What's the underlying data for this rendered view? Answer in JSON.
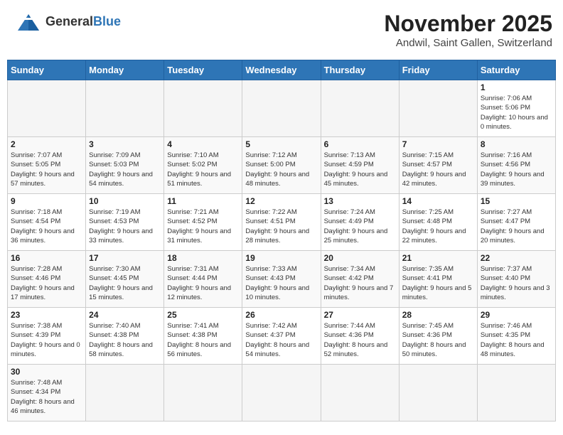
{
  "header": {
    "logo_general": "General",
    "logo_blue": "Blue",
    "month": "November 2025",
    "location": "Andwil, Saint Gallen, Switzerland"
  },
  "days_of_week": [
    "Sunday",
    "Monday",
    "Tuesday",
    "Wednesday",
    "Thursday",
    "Friday",
    "Saturday"
  ],
  "weeks": [
    [
      {
        "day": "",
        "info": ""
      },
      {
        "day": "",
        "info": ""
      },
      {
        "day": "",
        "info": ""
      },
      {
        "day": "",
        "info": ""
      },
      {
        "day": "",
        "info": ""
      },
      {
        "day": "",
        "info": ""
      },
      {
        "day": "1",
        "info": "Sunrise: 7:06 AM\nSunset: 5:06 PM\nDaylight: 10 hours and 0 minutes."
      }
    ],
    [
      {
        "day": "2",
        "info": "Sunrise: 7:07 AM\nSunset: 5:05 PM\nDaylight: 9 hours and 57 minutes."
      },
      {
        "day": "3",
        "info": "Sunrise: 7:09 AM\nSunset: 5:03 PM\nDaylight: 9 hours and 54 minutes."
      },
      {
        "day": "4",
        "info": "Sunrise: 7:10 AM\nSunset: 5:02 PM\nDaylight: 9 hours and 51 minutes."
      },
      {
        "day": "5",
        "info": "Sunrise: 7:12 AM\nSunset: 5:00 PM\nDaylight: 9 hours and 48 minutes."
      },
      {
        "day": "6",
        "info": "Sunrise: 7:13 AM\nSunset: 4:59 PM\nDaylight: 9 hours and 45 minutes."
      },
      {
        "day": "7",
        "info": "Sunrise: 7:15 AM\nSunset: 4:57 PM\nDaylight: 9 hours and 42 minutes."
      },
      {
        "day": "8",
        "info": "Sunrise: 7:16 AM\nSunset: 4:56 PM\nDaylight: 9 hours and 39 minutes."
      }
    ],
    [
      {
        "day": "9",
        "info": "Sunrise: 7:18 AM\nSunset: 4:54 PM\nDaylight: 9 hours and 36 minutes."
      },
      {
        "day": "10",
        "info": "Sunrise: 7:19 AM\nSunset: 4:53 PM\nDaylight: 9 hours and 33 minutes."
      },
      {
        "day": "11",
        "info": "Sunrise: 7:21 AM\nSunset: 4:52 PM\nDaylight: 9 hours and 31 minutes."
      },
      {
        "day": "12",
        "info": "Sunrise: 7:22 AM\nSunset: 4:51 PM\nDaylight: 9 hours and 28 minutes."
      },
      {
        "day": "13",
        "info": "Sunrise: 7:24 AM\nSunset: 4:49 PM\nDaylight: 9 hours and 25 minutes."
      },
      {
        "day": "14",
        "info": "Sunrise: 7:25 AM\nSunset: 4:48 PM\nDaylight: 9 hours and 22 minutes."
      },
      {
        "day": "15",
        "info": "Sunrise: 7:27 AM\nSunset: 4:47 PM\nDaylight: 9 hours and 20 minutes."
      }
    ],
    [
      {
        "day": "16",
        "info": "Sunrise: 7:28 AM\nSunset: 4:46 PM\nDaylight: 9 hours and 17 minutes."
      },
      {
        "day": "17",
        "info": "Sunrise: 7:30 AM\nSunset: 4:45 PM\nDaylight: 9 hours and 15 minutes."
      },
      {
        "day": "18",
        "info": "Sunrise: 7:31 AM\nSunset: 4:44 PM\nDaylight: 9 hours and 12 minutes."
      },
      {
        "day": "19",
        "info": "Sunrise: 7:33 AM\nSunset: 4:43 PM\nDaylight: 9 hours and 10 minutes."
      },
      {
        "day": "20",
        "info": "Sunrise: 7:34 AM\nSunset: 4:42 PM\nDaylight: 9 hours and 7 minutes."
      },
      {
        "day": "21",
        "info": "Sunrise: 7:35 AM\nSunset: 4:41 PM\nDaylight: 9 hours and 5 minutes."
      },
      {
        "day": "22",
        "info": "Sunrise: 7:37 AM\nSunset: 4:40 PM\nDaylight: 9 hours and 3 minutes."
      }
    ],
    [
      {
        "day": "23",
        "info": "Sunrise: 7:38 AM\nSunset: 4:39 PM\nDaylight: 9 hours and 0 minutes."
      },
      {
        "day": "24",
        "info": "Sunrise: 7:40 AM\nSunset: 4:38 PM\nDaylight: 8 hours and 58 minutes."
      },
      {
        "day": "25",
        "info": "Sunrise: 7:41 AM\nSunset: 4:38 PM\nDaylight: 8 hours and 56 minutes."
      },
      {
        "day": "26",
        "info": "Sunrise: 7:42 AM\nSunset: 4:37 PM\nDaylight: 8 hours and 54 minutes."
      },
      {
        "day": "27",
        "info": "Sunrise: 7:44 AM\nSunset: 4:36 PM\nDaylight: 8 hours and 52 minutes."
      },
      {
        "day": "28",
        "info": "Sunrise: 7:45 AM\nSunset: 4:36 PM\nDaylight: 8 hours and 50 minutes."
      },
      {
        "day": "29",
        "info": "Sunrise: 7:46 AM\nSunset: 4:35 PM\nDaylight: 8 hours and 48 minutes."
      }
    ],
    [
      {
        "day": "30",
        "info": "Sunrise: 7:48 AM\nSunset: 4:34 PM\nDaylight: 8 hours and 46 minutes."
      },
      {
        "day": "",
        "info": ""
      },
      {
        "day": "",
        "info": ""
      },
      {
        "day": "",
        "info": ""
      },
      {
        "day": "",
        "info": ""
      },
      {
        "day": "",
        "info": ""
      },
      {
        "day": "",
        "info": ""
      }
    ]
  ]
}
